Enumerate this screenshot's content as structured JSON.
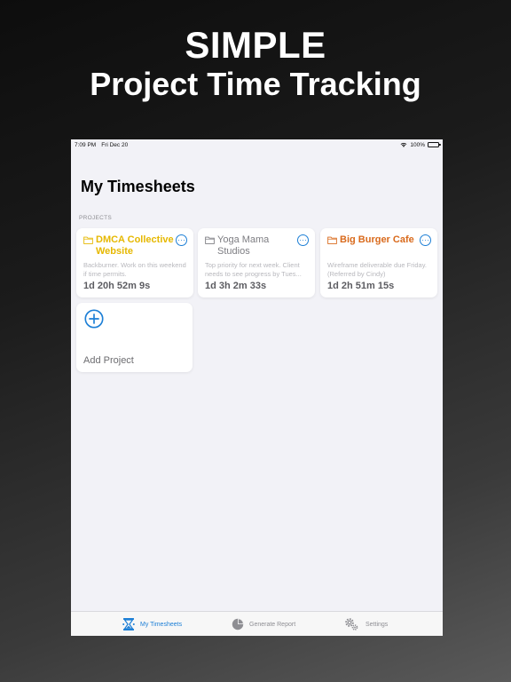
{
  "promo": {
    "headline": "SIMPLE",
    "subheadline": "Project Time Tracking"
  },
  "status_bar": {
    "time": "7:09 PM",
    "date": "Fri Dec 20",
    "battery": "100%"
  },
  "page": {
    "title": "My Timesheets",
    "section": "PROJECTS"
  },
  "projects": [
    {
      "name": "DMCA Collective Website",
      "description": "Backburner. Work on this weekend if time permits.",
      "time": "1d 20h 52m 9s",
      "color": "#e6b800"
    },
    {
      "name": "Yoga Mama Studios",
      "description": "Top priority for next week. Client needs to see progress by Tues...",
      "time": "1d 3h 2m 33s",
      "color": "#7d7d82"
    },
    {
      "name": "Big Burger Cafe",
      "description": "Wireframe deliverable due Friday. (Referred by Cindy)",
      "time": "1d 2h 51m 15s",
      "color": "#d96a1c"
    }
  ],
  "add_project": {
    "label": "Add Project"
  },
  "tabs": [
    {
      "label": "My Timesheets",
      "icon": "hourglass-icon",
      "active": true
    },
    {
      "label": "Generate Report",
      "icon": "pie-chart-icon",
      "active": false
    },
    {
      "label": "Settings",
      "icon": "gears-icon",
      "active": false
    }
  ],
  "colors": {
    "accent": "#1d7fd6",
    "inactive_tab": "#8e8e93"
  }
}
